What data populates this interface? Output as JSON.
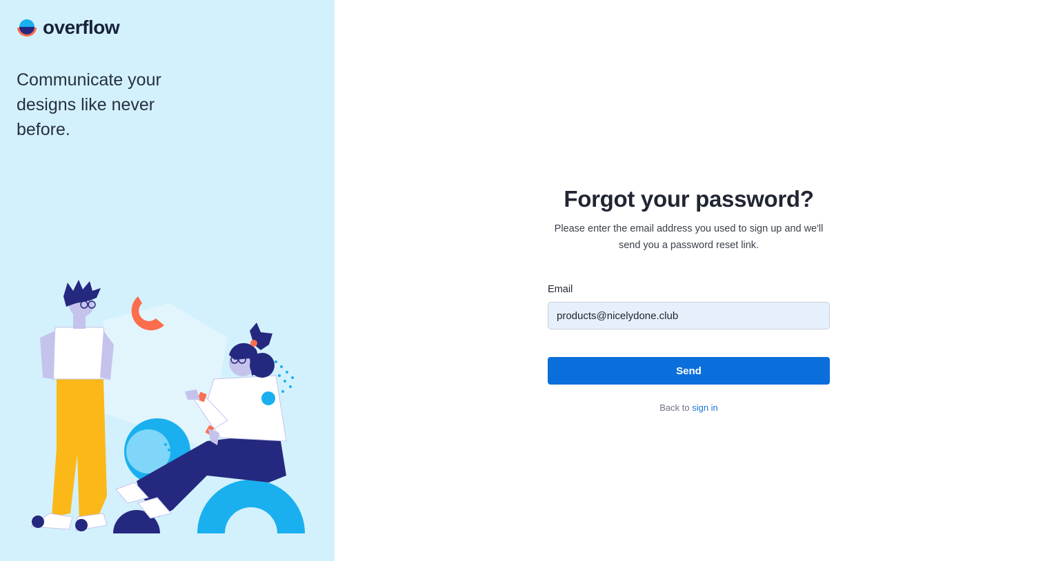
{
  "brand": {
    "name": "overflow",
    "colors": {
      "blue": "#1ab0ef",
      "navy": "#25287f",
      "orange": "#fb6d4c"
    }
  },
  "sidebar": {
    "tagline": "Communicate your designs like never before."
  },
  "form": {
    "title": "Forgot your password?",
    "subtitle": "Please enter the email address you used to sign up and we'll send you a password reset link.",
    "email_label": "Email",
    "email_value": "products@nicelydone.club",
    "send_label": "Send",
    "back_prefix": "Back to",
    "back_link": "sign in"
  },
  "colors": {
    "panel_bg": "#d3f1fc",
    "primary": "#0b6fdb",
    "input_bg": "#e6f0fd"
  }
}
